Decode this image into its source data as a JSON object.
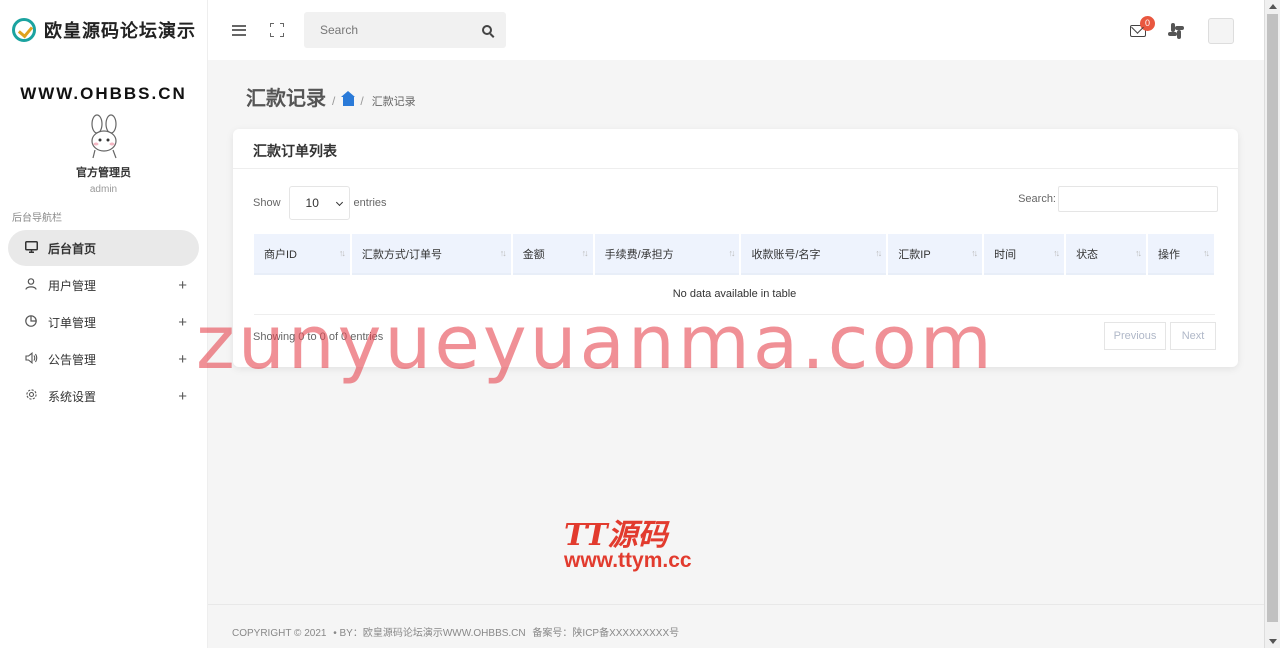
{
  "app": {
    "logo_text": "欧皇源码论坛演示",
    "site_url": "WWW.OHBBS.CN"
  },
  "profile": {
    "name": "官方管理员",
    "role": "admin"
  },
  "sidebar": {
    "nav_title": "后台导航栏",
    "items": [
      {
        "label": "后台首页",
        "icon": "monitor-icon",
        "active": true
      },
      {
        "label": "用户管理",
        "icon": "user-icon",
        "expandable": true
      },
      {
        "label": "订单管理",
        "icon": "pie-chart-icon",
        "expandable": true
      },
      {
        "label": "公告管理",
        "icon": "speaker-icon",
        "expandable": true
      },
      {
        "label": "系统设置",
        "icon": "gear-icon",
        "expandable": true
      }
    ]
  },
  "header": {
    "search_placeholder": "Search",
    "mail_badge": "0"
  },
  "page": {
    "title": "汇款记录",
    "breadcrumb_current": "汇款记录"
  },
  "card": {
    "title": "汇款订单列表",
    "show_label": "Show",
    "page_length": "10",
    "entries_label": "entries",
    "search_label": "Search:",
    "columns": [
      "商户ID",
      "汇款方式/订单号",
      "金额",
      "手续费/承担方",
      "收款账号/名字",
      "汇款IP",
      "时间",
      "状态",
      "操作"
    ],
    "empty_text": "No data available in table",
    "info_text": "Showing 0 to 0 of 0 entries",
    "prev_label": "Previous",
    "next_label": "Next"
  },
  "watermark": {
    "main": "zunyueyuanma.com",
    "tt_logo": "TT源码",
    "tt_url": "www.ttym.cc"
  },
  "footer": {
    "copyright": "COPYRIGHT © 2021",
    "by": "• BY：欧皇源码论坛演示WWW.OHBBS.CN",
    "icp": "备案号：陕ICP备XXXXXXXXX号"
  },
  "colors": {
    "accent": "#2a7ad8",
    "badge": "#e9573f",
    "table_header": "#eef3fd",
    "watermark": "#e64650"
  }
}
